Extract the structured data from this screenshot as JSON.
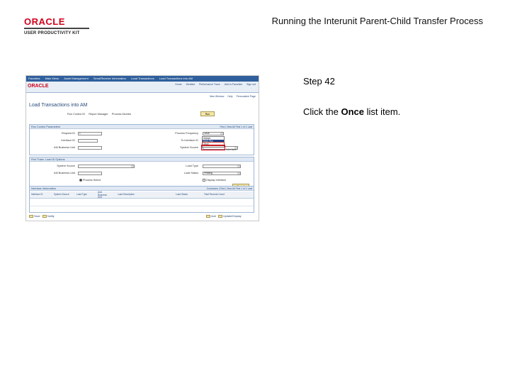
{
  "slide": {
    "brand_name": "ORACLE",
    "brand_sub": "USER PRODUCTIVITY KIT",
    "title": "Running the Interunit Parent-Child Transfer Process",
    "step": "Step 42",
    "instruction_prefix": "Click the ",
    "instruction_target": "Once",
    "instruction_suffix": " list item."
  },
  "screenshot": {
    "breadcrumb": [
      "Favorites",
      "Main Menu",
      "Asset Management",
      "Send/Receive Information",
      "Load Transactions",
      "Load Transactions into AM"
    ],
    "logo": "ORACLE",
    "header_links": [
      "Home",
      "Worklist",
      "Performance Trace",
      "Add to Favorites",
      "Sign out"
    ],
    "util_links": [
      "New Window",
      "Help",
      "Personalize Page"
    ],
    "page_title": "Load Transactions into AM",
    "controls": [
      "Run Control ID",
      "Report Manager",
      "Process Monitor"
    ],
    "run_button": "Run",
    "sec1_title": "Run Control Parameters",
    "sec1_nav": "Find | View All  First  1 of 1  Last",
    "fields_left": [
      {
        "label": "Request ID",
        "value": "1"
      },
      {
        "label": "Interface ID",
        "value": ""
      },
      {
        "label": "AM Business Unit",
        "value": ""
      }
    ],
    "fields_right": [
      {
        "label": "Process Frequency",
        "value": "Once"
      },
      {
        "label": "To Interface ID",
        "value": ""
      },
      {
        "label": "System Source",
        "value": ""
      }
    ],
    "dropdown_options": [
      "Always",
      "Don't Run",
      "Once"
    ],
    "dropdown_extra": "Interface",
    "sec2_title": "Find Trans. Load ID Options",
    "sec2_left": [
      {
        "label": "System Source",
        "value": ""
      },
      {
        "label": "AM Business Unit",
        "value": ""
      }
    ],
    "sec2_right": [
      {
        "label": "Load Type",
        "value": ""
      },
      {
        "label": "Load Status",
        "value": "Pending"
      }
    ],
    "radio_label": "Process Select",
    "check_label": "Display Interface",
    "search_button": "Search",
    "sec3_title": "Interface Information",
    "grid_nav": "Customize | Find | View All  First  1 of 1  Last",
    "grid_columns": [
      "Interface ID",
      "System Source",
      "Load Type",
      "Add Business Unit",
      "Load Description",
      "Load Status",
      "Total Records Count"
    ],
    "bottom_left": [
      "Save",
      "Notify"
    ],
    "bottom_right": [
      "Add",
      "Update/Display"
    ]
  }
}
